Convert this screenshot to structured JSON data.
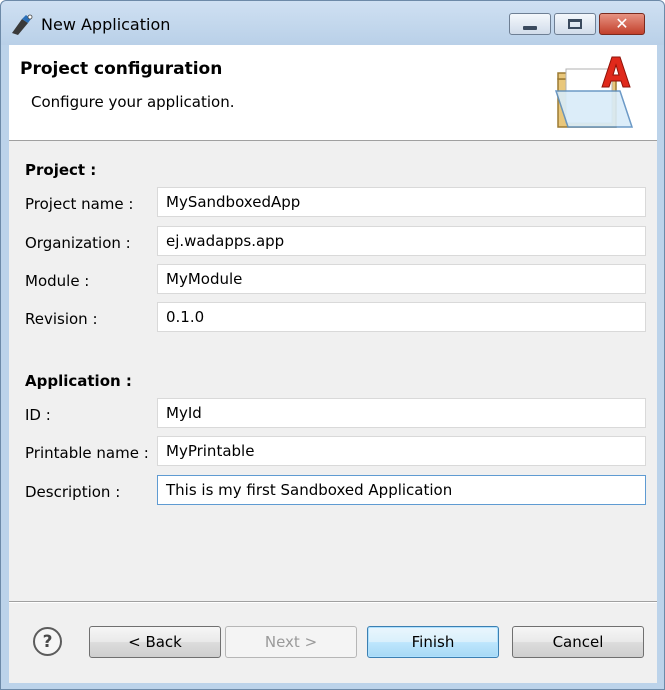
{
  "window": {
    "title": "New Application",
    "close_glyph": "✕"
  },
  "header": {
    "title": "Project configuration",
    "subtitle": "Configure your application."
  },
  "project": {
    "section_label": "Project :",
    "fields": [
      {
        "label": "Project name :",
        "value": "MySandboxedApp"
      },
      {
        "label": "Organization :",
        "value": "ej.wadapps.app"
      },
      {
        "label": "Module :",
        "value": "MyModule"
      },
      {
        "label": "Revision :",
        "value": "0.1.0"
      }
    ]
  },
  "application": {
    "section_label": "Application :",
    "fields": [
      {
        "label": "ID :",
        "value": "MyId"
      },
      {
        "label": "Printable name :",
        "value": "MyPrintable"
      },
      {
        "label": "Description :",
        "value": "This is my first Sandboxed Application"
      }
    ]
  },
  "footer": {
    "help_glyph": "?",
    "back_label": "< Back",
    "next_label": "Next >",
    "finish_label": "Finish",
    "cancel_label": "Cancel"
  },
  "icons": [
    "app-icon",
    "minimize-icon",
    "maximize-icon",
    "close-icon",
    "folder-application-icon",
    "help-icon"
  ],
  "colors": {
    "titlebar": "#bcd3ea",
    "close_button": "#c2402b",
    "default_button_border": "#3c7fb1",
    "focused_input_border": "#5f9bd2"
  }
}
